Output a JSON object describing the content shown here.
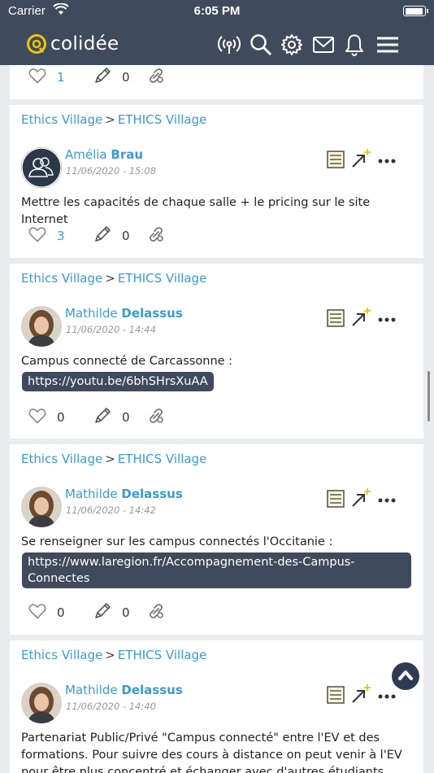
{
  "status_bar": {
    "carrier": "Carrier",
    "time": "6:05 PM",
    "battery_level": 0.92
  },
  "app": {
    "brand": "colidée"
  },
  "header_icons": [
    "broadcast-icon",
    "search-icon",
    "gear-icon",
    "mail-icon",
    "bell-icon",
    "menu-icon"
  ],
  "top_partial_post": {
    "likes": "1",
    "edits": "0"
  },
  "posts": [
    {
      "breadcrumb": {
        "left": "Ethics Village",
        "sep": ">",
        "right": "ETHICS Village"
      },
      "author": {
        "first": "Amélia",
        "last": "Brau"
      },
      "date": "11/06/2020 - 15:08",
      "text": "Mettre les capacités de chaque salle + le pricing sur le site Internet",
      "link": "",
      "likes": "3",
      "edits": "0"
    },
    {
      "breadcrumb": {
        "left": "Ethics Village",
        "sep": ">",
        "right": "ETHICS Village"
      },
      "author": {
        "first": "Mathilde",
        "last": "Delassus"
      },
      "date": "11/06/2020 - 14:44",
      "text": "Campus connecté de Carcassonne :",
      "link": "https://youtu.be/6bhSHrsXuAA",
      "likes": "0",
      "edits": "0"
    },
    {
      "breadcrumb": {
        "left": "Ethics Village",
        "sep": ">",
        "right": "ETHICS Village"
      },
      "author": {
        "first": "Mathilde",
        "last": "Delassus"
      },
      "date": "11/06/2020 - 14:42",
      "text": "Se renseigner sur les campus connectés l'Occitanie :",
      "link_line1": "https://www.laregion.fr/Accompagnement-des-Campus-",
      "link_line2": "Connectes",
      "likes": "0",
      "edits": "0"
    },
    {
      "breadcrumb": {
        "left": "Ethics Village",
        "sep": ">",
        "right": "ETHICS Village"
      },
      "author": {
        "first": "Mathilde",
        "last": "Delassus"
      },
      "date": "11/06/2020 - 14:40",
      "text_line1": "Partenariat Public/Privé \"Campus connecté\" entre l'EV et des",
      "text_line2": "formations. Pour suivre des cours à distance on peut venir à l'EV",
      "text_line3": "pour être plus concentré et échanger avec d'autres étudiants"
    }
  ],
  "colors": {
    "header_bg": "#3f4a5c",
    "link_blue": "#3a9ad1",
    "accent_yellow": "#f2c200",
    "feed_bg": "#e9ebee"
  }
}
